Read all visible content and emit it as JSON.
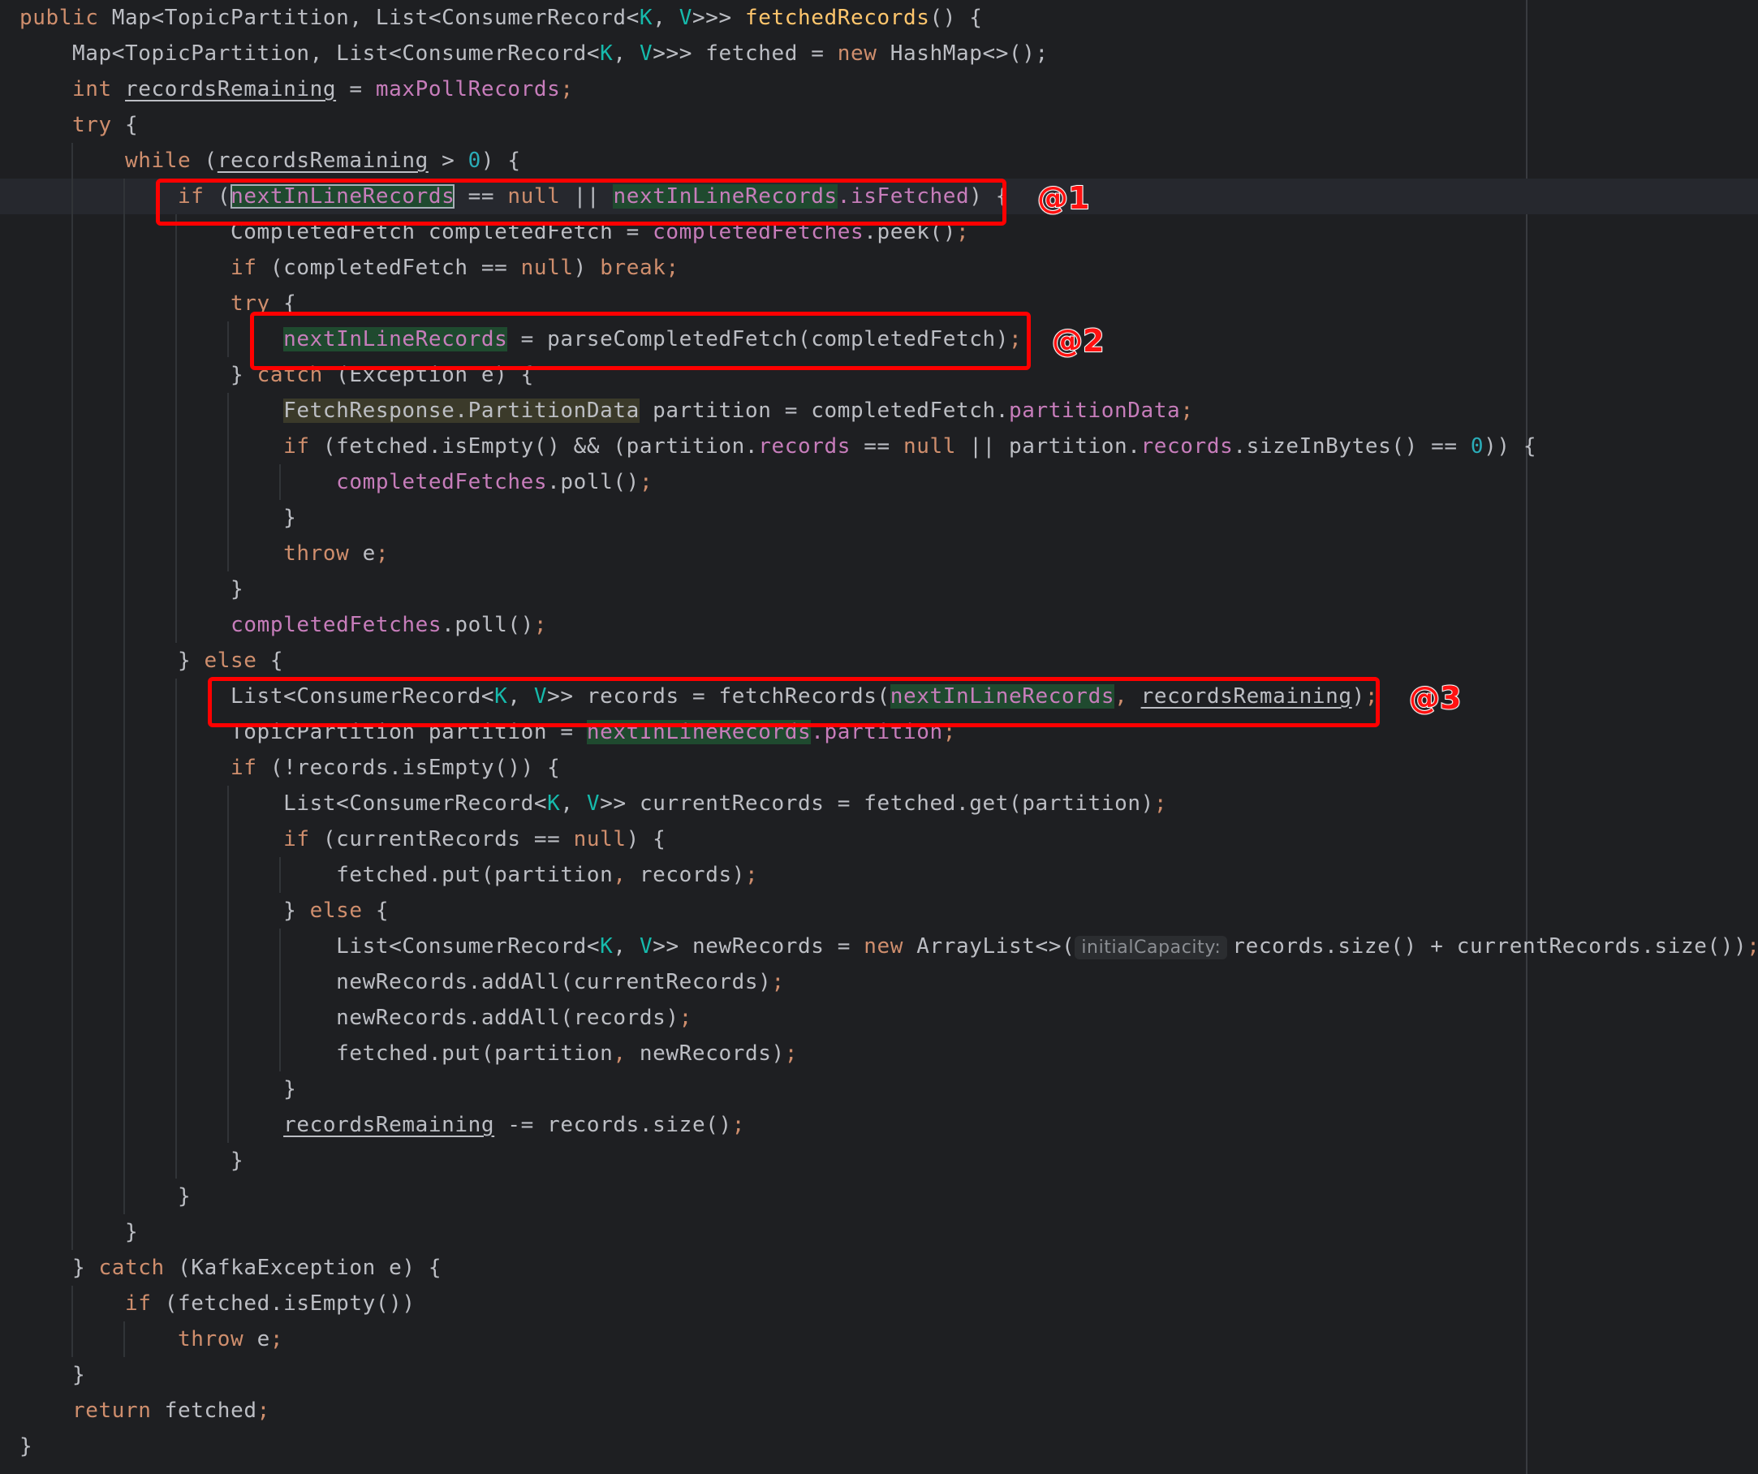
{
  "editor": {
    "lines": [
      [
        [
          "kw",
          "public "
        ],
        [
          "pl",
          "Map<TopicPartition, List<ConsumerRecord<"
        ],
        [
          "gen",
          "K"
        ],
        [
          "pl",
          ", "
        ],
        [
          "gen",
          "V"
        ],
        [
          "pl",
          ">>> "
        ],
        [
          "fn",
          "fetchedRecords"
        ],
        [
          "pl",
          "() {"
        ]
      ],
      [
        [
          "pl",
          "    Map<TopicPartition, List<ConsumerRecord<"
        ],
        [
          "gen",
          "K"
        ],
        [
          "pl",
          ", "
        ],
        [
          "gen",
          "V"
        ],
        [
          "pl",
          ">>> fetched = "
        ],
        [
          "kw",
          "new "
        ],
        [
          "pl",
          "HashMap<>();"
        ]
      ],
      [
        [
          "kw",
          "    int "
        ],
        [
          "varu",
          "recordsRemaining"
        ],
        [
          "pl",
          " = "
        ],
        [
          "fld",
          "maxPollRecords"
        ],
        [
          "kw",
          ";"
        ]
      ],
      [
        [
          "kw",
          "    try "
        ],
        [
          "pl",
          "{"
        ]
      ],
      [
        [
          "kw",
          "        while "
        ],
        [
          "pl",
          "("
        ],
        [
          "varu",
          "recordsRemaining"
        ],
        [
          "pl",
          " > "
        ],
        [
          "num",
          "0"
        ],
        [
          "pl",
          ") {"
        ]
      ],
      [
        [
          "kw",
          "            if "
        ],
        [
          "pl",
          "("
        ],
        [
          "hlsel",
          "nextInLineRecords"
        ],
        [
          "pl",
          " == "
        ],
        [
          "kw",
          "null"
        ],
        [
          "pl",
          " || "
        ],
        [
          "hl",
          "nextInLineRecords"
        ],
        [
          "fld",
          ".isFetched"
        ],
        [
          "pl",
          ") {"
        ]
      ],
      [
        [
          "pl",
          "                CompletedFetch completedFetch = "
        ],
        [
          "fld",
          "completedFetches"
        ],
        [
          "pl",
          ".peek()"
        ],
        [
          "kw",
          ";"
        ]
      ],
      [
        [
          "kw",
          "                if "
        ],
        [
          "pl",
          "(completedFetch == "
        ],
        [
          "kw",
          "null"
        ],
        [
          "pl",
          ") "
        ],
        [
          "kw",
          "break;"
        ]
      ],
      [
        [
          "kw",
          "                try "
        ],
        [
          "pl",
          "{"
        ]
      ],
      [
        [
          "pl",
          "                    "
        ],
        [
          "hl",
          "nextInLineRecords"
        ],
        [
          "pl",
          " = parseCompletedFetch(completedFetch)"
        ],
        [
          "kw",
          ";"
        ]
      ],
      [
        [
          "pl",
          "                } "
        ],
        [
          "kw",
          "catch "
        ],
        [
          "pl",
          "(Exception e) {"
        ]
      ],
      [
        [
          "pl",
          "                    "
        ],
        [
          "clshl",
          "FetchResponse.PartitionData"
        ],
        [
          "pl",
          " partition = completedFetch."
        ],
        [
          "fld",
          "partitionData"
        ],
        [
          "kw",
          ";"
        ]
      ],
      [
        [
          "kw",
          "                    if "
        ],
        [
          "pl",
          "(fetched.isEmpty() && (partition."
        ],
        [
          "fld",
          "records"
        ],
        [
          "pl",
          " == "
        ],
        [
          "kw",
          "null"
        ],
        [
          "pl",
          " || partition."
        ],
        [
          "fld",
          "records"
        ],
        [
          "pl",
          ".sizeInBytes() == "
        ],
        [
          "num",
          "0"
        ],
        [
          "pl",
          ")) {"
        ]
      ],
      [
        [
          "pl",
          "                        "
        ],
        [
          "fld",
          "completedFetches"
        ],
        [
          "pl",
          ".poll()"
        ],
        [
          "kw",
          ";"
        ]
      ],
      [
        [
          "pl",
          "                    }"
        ]
      ],
      [
        [
          "kw",
          "                    throw "
        ],
        [
          "pl",
          "e"
        ],
        [
          "kw",
          ";"
        ]
      ],
      [
        [
          "pl",
          "                }"
        ]
      ],
      [
        [
          "pl",
          "                "
        ],
        [
          "fld",
          "completedFetches"
        ],
        [
          "pl",
          ".poll()"
        ],
        [
          "kw",
          ";"
        ]
      ],
      [
        [
          "pl",
          "            } "
        ],
        [
          "kw",
          "else "
        ],
        [
          "pl",
          "{"
        ]
      ],
      [
        [
          "pl",
          "                List<ConsumerRecord<"
        ],
        [
          "gen",
          "K"
        ],
        [
          "pl",
          ", "
        ],
        [
          "gen",
          "V"
        ],
        [
          "pl",
          ">> records = fetchRecords("
        ],
        [
          "hl",
          "nextInLineRecords"
        ],
        [
          "kw",
          ", "
        ],
        [
          "varu",
          "recordsRemaining"
        ],
        [
          "pl",
          ")"
        ],
        [
          "kw",
          ";"
        ]
      ],
      [
        [
          "pl",
          "                TopicPartition partition = "
        ],
        [
          "hl",
          "nextInLineRecords"
        ],
        [
          "fld",
          ".partition"
        ],
        [
          "kw",
          ";"
        ]
      ],
      [
        [
          "kw",
          "                if "
        ],
        [
          "pl",
          "(!records.isEmpty()) {"
        ]
      ],
      [
        [
          "pl",
          "                    List<ConsumerRecord<"
        ],
        [
          "gen",
          "K"
        ],
        [
          "pl",
          ", "
        ],
        [
          "gen",
          "V"
        ],
        [
          "pl",
          ">> currentRecords = fetched.get(partition)"
        ],
        [
          "kw",
          ";"
        ]
      ],
      [
        [
          "kw",
          "                    if "
        ],
        [
          "pl",
          "(currentRecords == "
        ],
        [
          "kw",
          "null"
        ],
        [
          "pl",
          ") {"
        ]
      ],
      [
        [
          "pl",
          "                        fetched.put(partition"
        ],
        [
          "kw",
          ", "
        ],
        [
          "pl",
          "records)"
        ],
        [
          "kw",
          ";"
        ]
      ],
      [
        [
          "pl",
          "                    } "
        ],
        [
          "kw",
          "else "
        ],
        [
          "pl",
          "{"
        ]
      ],
      [
        [
          "pl",
          "                        List<ConsumerRecord<"
        ],
        [
          "gen",
          "K"
        ],
        [
          "pl",
          ", "
        ],
        [
          "gen",
          "V"
        ],
        [
          "pl",
          ">> newRecords = "
        ],
        [
          "kw",
          "new "
        ],
        [
          "pl",
          "ArrayList<>("
        ],
        [
          "hint",
          "initialCapacity:"
        ],
        [
          "pl",
          "records.size() + currentRecords.size())"
        ],
        [
          "kw",
          ";"
        ]
      ],
      [
        [
          "pl",
          "                        newRecords.addAll(currentRecords)"
        ],
        [
          "kw",
          ";"
        ]
      ],
      [
        [
          "pl",
          "                        newRecords.addAll(records)"
        ],
        [
          "kw",
          ";"
        ]
      ],
      [
        [
          "pl",
          "                        fetched.put(partition"
        ],
        [
          "kw",
          ", "
        ],
        [
          "pl",
          "newRecords)"
        ],
        [
          "kw",
          ";"
        ]
      ],
      [
        [
          "pl",
          "                    }"
        ]
      ],
      [
        [
          "pl",
          "                    "
        ],
        [
          "varu",
          "recordsRemaining"
        ],
        [
          "pl",
          " -= records.size()"
        ],
        [
          "kw",
          ";"
        ]
      ],
      [
        [
          "pl",
          "                }"
        ]
      ],
      [
        [
          "pl",
          "            }"
        ]
      ],
      [
        [
          "pl",
          "        }"
        ]
      ],
      [
        [
          "pl",
          "    } "
        ],
        [
          "kw",
          "catch "
        ],
        [
          "pl",
          "(KafkaException e) {"
        ]
      ],
      [
        [
          "kw",
          "        if "
        ],
        [
          "pl",
          "(fetched.isEmpty())"
        ]
      ],
      [
        [
          "kw",
          "            throw "
        ],
        [
          "pl",
          "e"
        ],
        [
          "kw",
          ";"
        ]
      ],
      [
        [
          "pl",
          "    }"
        ]
      ],
      [
        [
          "kw",
          "    return "
        ],
        [
          "pl",
          "fetched"
        ],
        [
          "kw",
          ";"
        ]
      ],
      [
        [
          "pl",
          "}"
        ]
      ]
    ]
  },
  "annotations": [
    {
      "label": "@1"
    },
    {
      "label": "@2"
    },
    {
      "label": "@3"
    }
  ],
  "colors": {
    "background": "#1e1f22",
    "keyword": "#cf8e6d",
    "function": "#ffc66d",
    "field": "#c77dbb",
    "number": "#2aacb8",
    "generic": "#16baac",
    "annotation": "#ff0000"
  }
}
